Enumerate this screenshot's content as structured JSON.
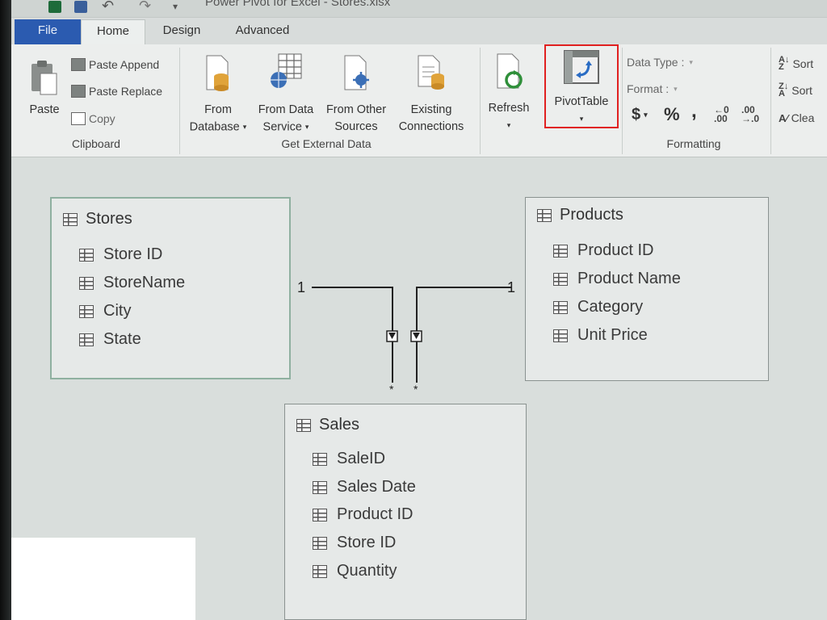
{
  "app": {
    "title": "Power Pivot for Excel - Stores.xlsx"
  },
  "tabs": [
    {
      "label": "File"
    },
    {
      "label": "Home"
    },
    {
      "label": "Design"
    },
    {
      "label": "Advanced"
    }
  ],
  "ribbon": {
    "clipboard": {
      "label": "Clipboard",
      "paste": "Paste",
      "paste_append": "Paste Append",
      "paste_replace": "Paste Replace",
      "copy": "Copy"
    },
    "external": {
      "label": "Get External Data",
      "from_database_1": "From",
      "from_database_2": "Database",
      "from_data_service_1": "From Data",
      "from_data_service_2": "Service",
      "from_other_1": "From Other",
      "from_other_2": "Sources",
      "existing_1": "Existing",
      "existing_2": "Connections"
    },
    "refresh": "Refresh",
    "pivottable": "PivotTable",
    "formatting": {
      "label": "Formatting",
      "data_type": "Data Type :",
      "format": "Format :",
      "currency": "$",
      "percent": "%",
      "comma": ","
    },
    "sort": {
      "sort_asc": "Sort",
      "sort_desc": "Sort",
      "clear": "Clea"
    }
  },
  "diagram": {
    "tables": [
      {
        "name": "Stores",
        "fields": [
          "Store ID",
          "StoreName",
          "City",
          "State"
        ]
      },
      {
        "name": "Products",
        "fields": [
          "Product ID",
          "Product Name",
          "Category",
          "Unit Price"
        ]
      },
      {
        "name": "Sales",
        "fields": [
          "SaleID",
          "Sales Date",
          "Product ID",
          "Store ID",
          "Quantity"
        ]
      }
    ],
    "relationships": [
      {
        "from": "Stores",
        "to": "Sales",
        "one": "1",
        "many": "*"
      },
      {
        "from": "Products",
        "to": "Sales",
        "one": "1",
        "many": "*"
      }
    ]
  },
  "colors": {
    "file_tab": "#2b5bb0",
    "highlight_border": "#e02020",
    "canvas": "#d9dedc"
  }
}
